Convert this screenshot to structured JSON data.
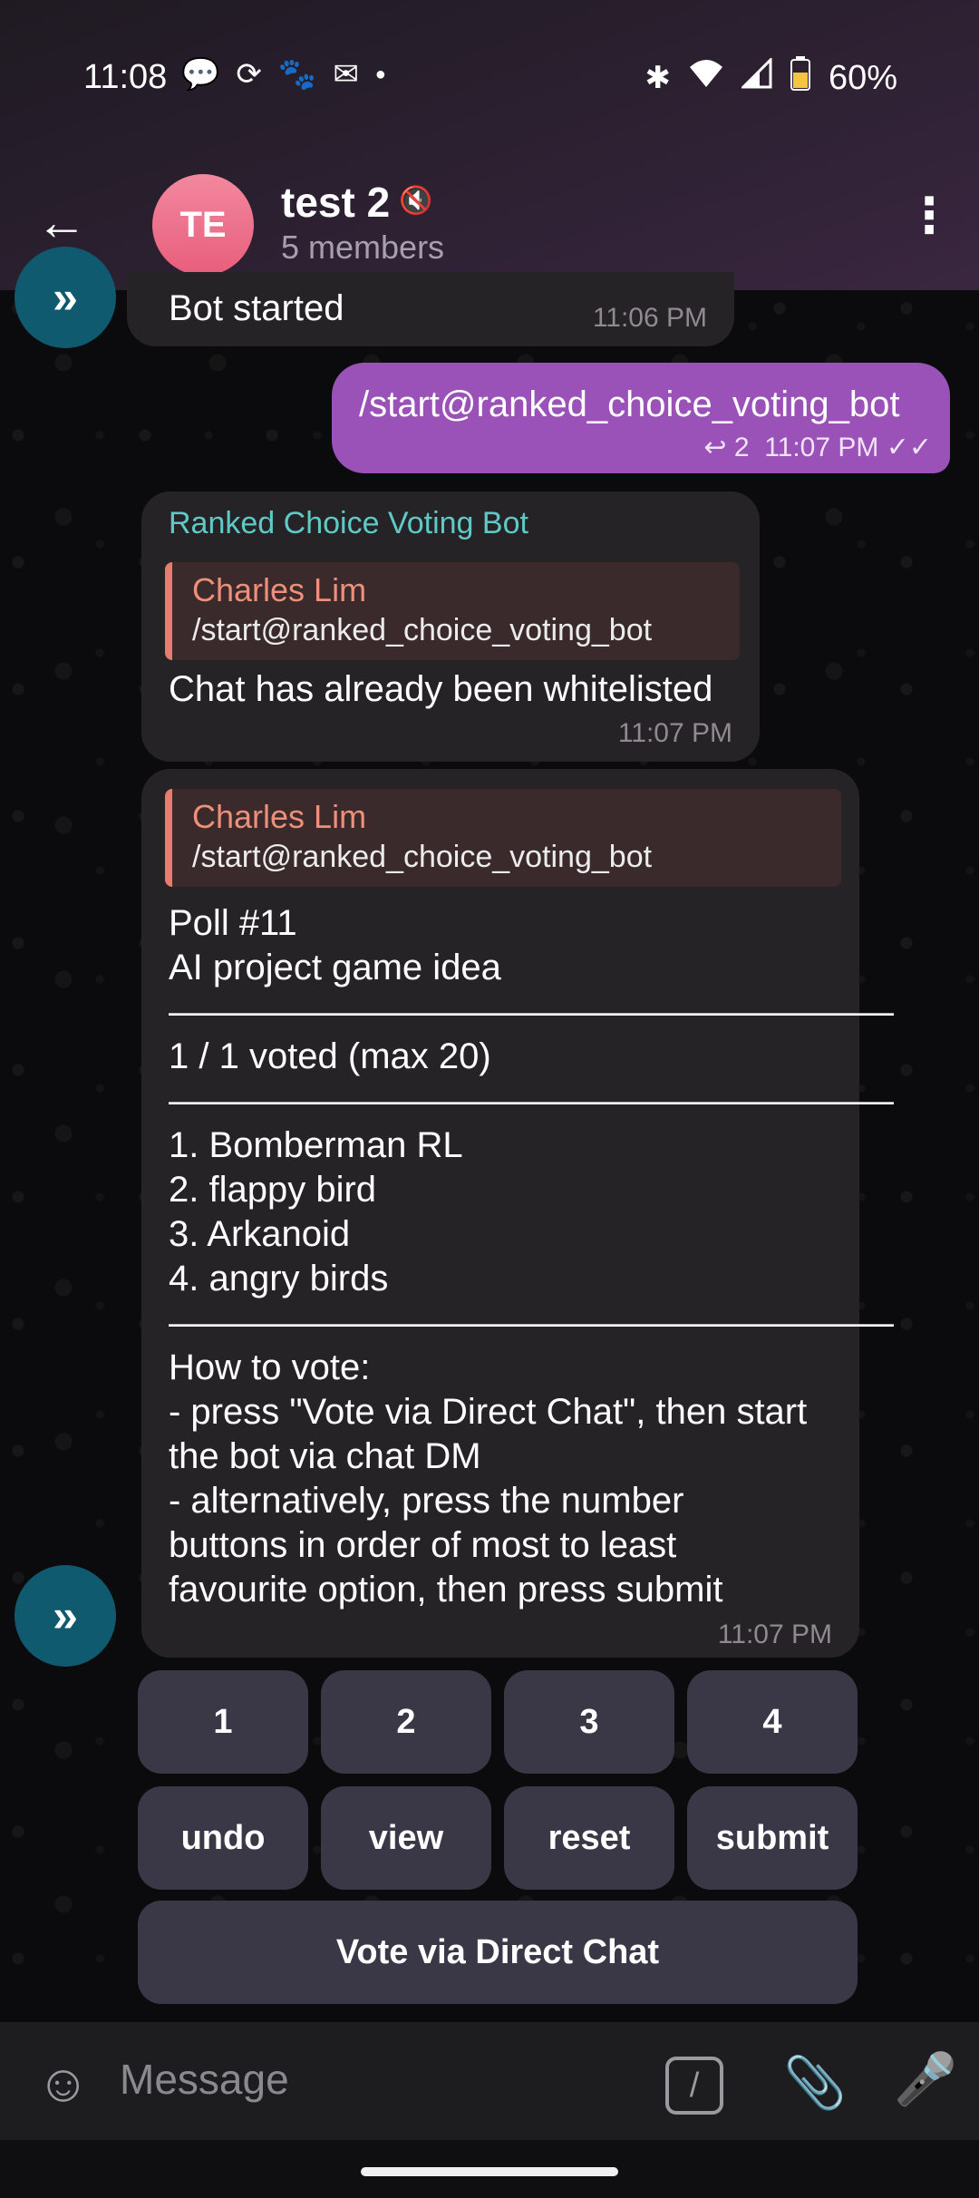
{
  "status": {
    "time": "11:08",
    "battery": "60%",
    "left_icons": [
      "chat-bubble-icon",
      "sync-icon",
      "cat-icon",
      "gmail-icon",
      "dot-icon"
    ],
    "right_icons": [
      "bluetooth-icon",
      "wifi-icon",
      "signal-icon",
      "battery-icon"
    ]
  },
  "header": {
    "avatar_initials": "TE",
    "title": "test 2",
    "subtitle": "5 members"
  },
  "messages": {
    "bot_started": {
      "text": "Bot started",
      "time": "11:06 PM"
    },
    "outgoing": {
      "text": "/start@ranked_choice_voting_bot",
      "reply_count": "2",
      "time": "11:07 PM"
    },
    "whitelist": {
      "sender": "Ranked Choice Voting Bot",
      "quote_name": "Charles Lim",
      "quote_text": "/start@ranked_choice_voting_bot",
      "text": "Chat has already been whitelisted",
      "time": "11:07 PM"
    },
    "poll": {
      "quote_name": "Charles Lim",
      "quote_text": "/start@ranked_choice_voting_bot",
      "lines": [
        "Poll #11",
        "AI project game idea",
        "————————————————————",
        "1 / 1 voted (max 20)",
        "————————————————————",
        "1. Bomberman RL",
        "2. flappy bird",
        "3. Arkanoid",
        "4. angry birds",
        "————————————————————",
        "How to vote:",
        "- press \"Vote via Direct Chat\", then start",
        "the bot via chat DM",
        "- alternatively, press the number",
        "buttons in order of most to least",
        "favourite option, then press submit"
      ],
      "time": "11:07 PM"
    }
  },
  "keyboard": {
    "row1": [
      "1",
      "2",
      "3",
      "4"
    ],
    "row2": [
      "undo",
      "view",
      "reset",
      "submit"
    ],
    "direct": "Vote via Direct Chat"
  },
  "input": {
    "placeholder": "Message"
  }
}
